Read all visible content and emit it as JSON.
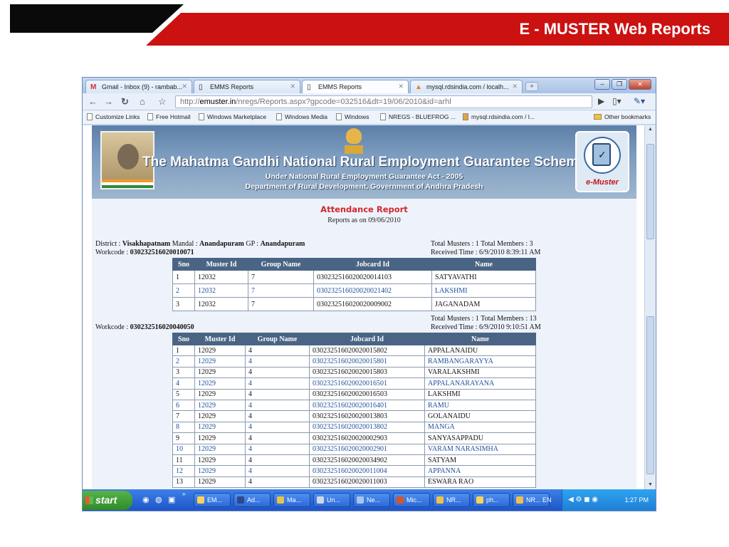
{
  "slide": {
    "title": "E - MUSTER Web Reports"
  },
  "browser": {
    "tabs": [
      {
        "label": "Gmail - Inbox (9) - rambab...",
        "icon": "gmail-icon"
      },
      {
        "label": "EMMS Reports",
        "icon": "page-icon"
      },
      {
        "label": "EMMS Reports",
        "icon": "page-icon",
        "active": true
      },
      {
        "label": "mysql.rdsindia.com / localh...",
        "icon": "pma-icon"
      }
    ],
    "address": {
      "prefix": "http://",
      "host": "emuster.in",
      "path": "/nregs/Reports.aspx?gpcode=032516&dt=19/06/2010&id=arhl"
    },
    "bookmarks": [
      "Customize Links",
      "Free Hotmail",
      "Windows Marketplace",
      "Windows Media",
      "Windows",
      "NREGS - BLUEFROG ...",
      "mysql.rdsindia.com / l..."
    ],
    "other_bookmarks": "Other bookmarks"
  },
  "banner": {
    "title": "The Mahatma Gandhi National Rural Employment Guarantee Scheme",
    "sub1": "Under National Rural Employment Guarantee Act - 2005",
    "sub2": "Department of Rural Development, Government of Andhra Pradesh",
    "logo_text": "e-Muster"
  },
  "report": {
    "title": "Attendance Report",
    "subtitle": "Reports as on 09/06/2010",
    "district_line": {
      "district_label": "District : ",
      "district": "Visakhapatnam",
      "mandal_label": " Mandal : ",
      "mandal": "Anandapuram",
      "gp_label": " GP : ",
      "gp": "Anandapuram"
    },
    "columns": [
      "Sno",
      "Muster Id",
      "Group Name",
      "Jobcard Id",
      "Name"
    ],
    "workcodes": [
      {
        "label": "Workcode : ",
        "code": "030232516020010071",
        "totals": "Total Musters : 1 Total Members : 3",
        "received": "Received Time : 6/9/2010 8:39:11 AM",
        "rows": [
          [
            "1",
            "12032",
            "7",
            "030232516020020014103",
            "SATYAVATHI"
          ],
          [
            "2",
            "12032",
            "7",
            "030232516020020021402",
            "LAKSHMI"
          ],
          [
            "3",
            "12032",
            "7",
            "030232516020020009002",
            "JAGANADAM"
          ]
        ]
      },
      {
        "label": "Workcode : ",
        "code": "030232516020040050",
        "totals": "Total Musters : 1 Total Members : 13",
        "received": "Received Time : 6/9/2010 9:10:51 AM",
        "rows": [
          [
            "1",
            "12029",
            "4",
            "030232516020020015802",
            "APPALANAIDU"
          ],
          [
            "2",
            "12029",
            "4",
            "030232516020020015801",
            "RAMBANGARAYYA"
          ],
          [
            "3",
            "12029",
            "4",
            "030232516020020015803",
            "VARALAKSHMI"
          ],
          [
            "4",
            "12029",
            "4",
            "030232516020020016501",
            "APPALANARAYANA"
          ],
          [
            "5",
            "12029",
            "4",
            "030232516020020016503",
            "LAKSHMI"
          ],
          [
            "6",
            "12029",
            "4",
            "030232516020020016401",
            "RAMU"
          ],
          [
            "7",
            "12029",
            "4",
            "030232516020020013803",
            "GOLANAIDU"
          ],
          [
            "8",
            "12029",
            "4",
            "030232516020020013802",
            "MANGA"
          ],
          [
            "9",
            "12029",
            "4",
            "030232516020020002903",
            "SANYASAPPADU"
          ],
          [
            "10",
            "12029",
            "4",
            "030232516020020002901",
            "VARAM NARASIMHA"
          ],
          [
            "11",
            "12029",
            "4",
            "030232516020020034902",
            "SATYAM"
          ],
          [
            "12",
            "12029",
            "4",
            "030232516020020011004",
            "APPANNA"
          ],
          [
            "13",
            "12029",
            "4",
            "030232516020020011003",
            "ESWARA RAO"
          ]
        ]
      }
    ]
  },
  "taskbar": {
    "start": "start",
    "tasks": [
      "EM...",
      "Ad...",
      "Ma...",
      "Un...",
      "Ne...",
      "Mic...",
      "NR...",
      "ph...",
      "NR..."
    ],
    "lang": "EN",
    "clock": "1:27 PM"
  }
}
